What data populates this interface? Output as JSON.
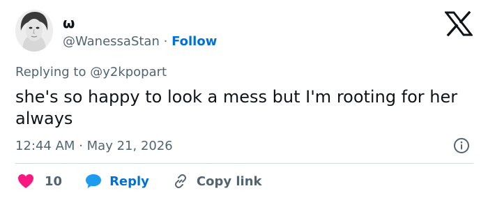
{
  "user": {
    "display_name": "ω",
    "handle": "@WanessaStan",
    "separator": "·",
    "follow_label": "Follow"
  },
  "reply_to": {
    "prefix": "Replying to",
    "handle": "@y2kpopart"
  },
  "tweet": {
    "text": "she's so happy to look a mess but I'm rooting for her always",
    "time": "12:44 AM",
    "separator": "·",
    "date": "May 21, 2026"
  },
  "actions": {
    "likes": "10",
    "reply_label": "Reply",
    "copy_label": "Copy link"
  },
  "colors": {
    "text": "#0f1419",
    "secondary": "#536471",
    "link": "#006fd6",
    "heart": "#f91880",
    "divider": "#cfd9de"
  },
  "icons": {
    "logo": "x-logo-icon",
    "info": "info-icon",
    "like": "heart-icon",
    "reply": "reply-bubble-icon",
    "copy": "link-icon"
  }
}
